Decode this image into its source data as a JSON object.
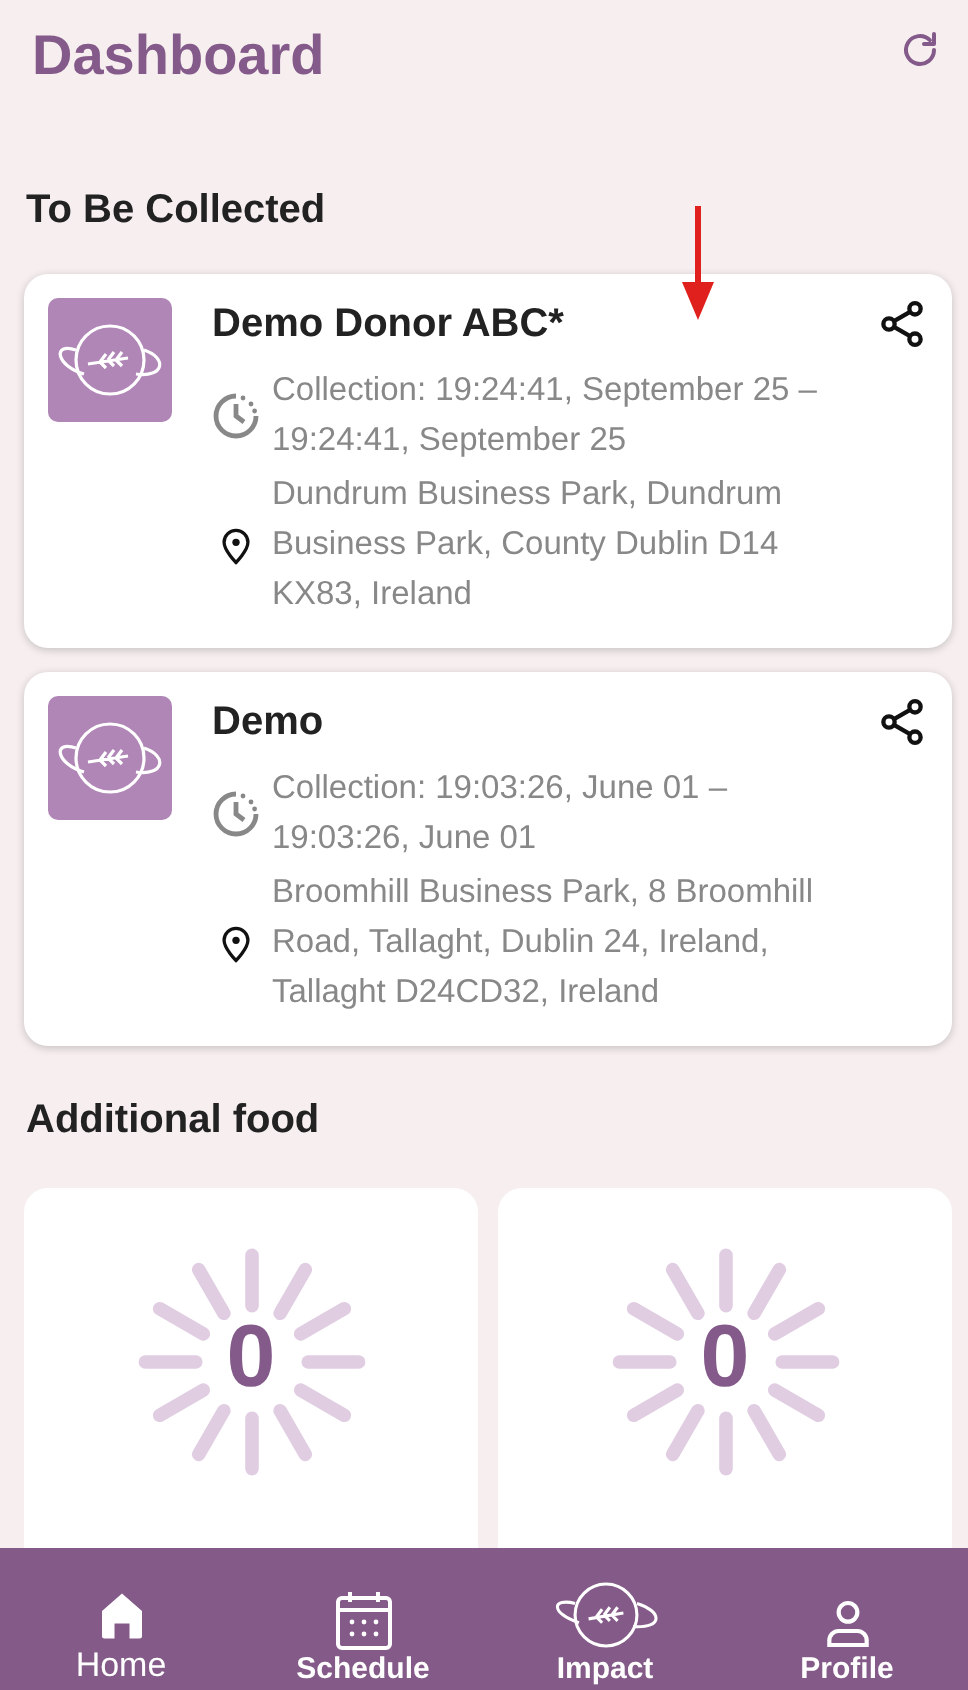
{
  "header": {
    "title": "Dashboard"
  },
  "to_be_collected": {
    "title": "To Be Collected",
    "items": [
      {
        "donor": "Demo Donor ABC*",
        "collection": "Collection: 19:24:41, September 25 – 19:24:41, September 25",
        "address": "Dundrum Business Park, Dundrum Business Park, County Dublin D14 KX83, Ireland"
      },
      {
        "donor": "Demo",
        "collection": "Collection: 19:03:26, June 01 – 19:03:26, June 01",
        "address": "Broomhill Business Park, 8 Broomhill Road, Tallaght, Dublin 24, Ireland, Tallaght D24CD32, Ireland"
      }
    ]
  },
  "additional_food": {
    "title": "Additional food",
    "tiles": [
      {
        "count": "0"
      },
      {
        "count": "0"
      }
    ]
  },
  "bottom_nav": [
    {
      "label": "Home",
      "kind": "home",
      "selected": true
    },
    {
      "label": "Schedule",
      "kind": "calendar",
      "selected": false
    },
    {
      "label": "Impact",
      "kind": "planet",
      "selected": false
    },
    {
      "label": "Profile",
      "kind": "person",
      "selected": false
    }
  ]
}
